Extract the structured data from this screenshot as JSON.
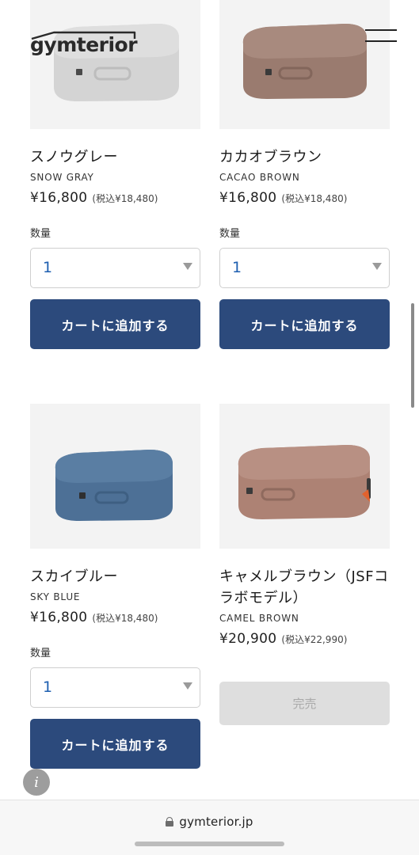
{
  "site": {
    "logo_text": "gymterior"
  },
  "quantity_label": "数量",
  "cart_button_label": "カートに追加する",
  "products": [
    {
      "name_ja": "スノウグレー",
      "name_en": "SNOW GRAY",
      "price": "¥16,800",
      "tax_price": "(税込¥18,480)",
      "quantity": "1",
      "color": "#d2d2d2",
      "status": "available"
    },
    {
      "name_ja": "カカオブラウン",
      "name_en": "CACAO BROWN",
      "price": "¥16,800",
      "tax_price": "(税込¥18,480)",
      "quantity": "1",
      "color": "#9c7e72",
      "status": "available"
    },
    {
      "name_ja": "スカイブルー",
      "name_en": "SKY BLUE",
      "price": "¥16,800",
      "tax_price": "(税込¥18,480)",
      "quantity": "1",
      "color": "#4f7397",
      "status": "available"
    },
    {
      "name_ja": "キャメルブラウン（JSFコラボモデル）",
      "name_en": "CAMEL BROWN",
      "price": "¥20,900",
      "tax_price": "(税込¥22,990)",
      "status": "sold-out",
      "soldout_label": "完売",
      "color": "#b08679"
    }
  ],
  "browser": {
    "url": "gymterior.jp"
  },
  "info_icon_glyph": "i",
  "colors": {
    "button": "#2c4a7c",
    "qty_value": "#1e5fb0",
    "image_bg": "#f3f3f3",
    "soldout_bg": "#dedede"
  },
  "icons": [
    "hamburger-menu-icon",
    "dropdown-arrow-icon",
    "lock-icon",
    "info-icon"
  ]
}
